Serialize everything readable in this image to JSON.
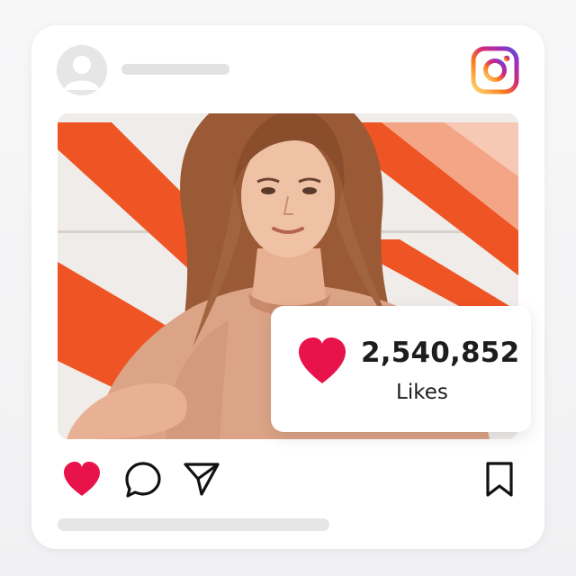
{
  "post": {
    "avatar_icon": "user-avatar-icon",
    "platform_logo": "instagram-logo",
    "likes": {
      "count": "2,540,852",
      "label": "Likes",
      "icon": "heart-icon",
      "color": "#e8134a"
    },
    "actions": {
      "like_icon": "heart-filled-icon",
      "comment_icon": "comment-icon",
      "share_icon": "send-icon",
      "save_icon": "bookmark-icon"
    }
  },
  "colors": {
    "heart": "#e8134a",
    "card_bg": "#ffffff",
    "placeholder": "#e2e2e2",
    "stripe_orange": "#ef5424",
    "stripe_peach": "#f3a585"
  }
}
